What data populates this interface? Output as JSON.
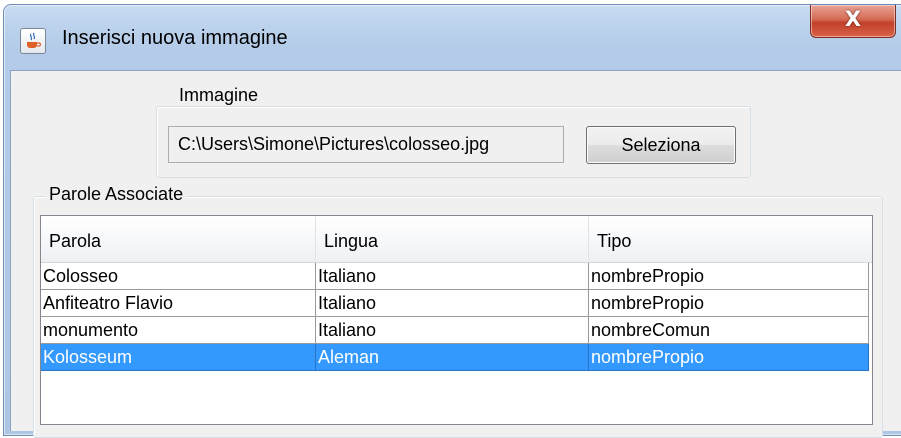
{
  "window": {
    "title": "Inserisci nuova immagine",
    "close_label": "X"
  },
  "image_group": {
    "legend": "Immagine",
    "path_value": "C:\\Users\\Simone\\Pictures\\colosseo.jpg",
    "select_button": "Seleziona"
  },
  "words_group": {
    "legend": "Parole Associate",
    "columns": [
      "Parola",
      "Lingua",
      "Tipo"
    ],
    "rows": [
      [
        "Colosseo",
        "Italiano",
        "nombrePropio"
      ],
      [
        "Anfiteatro Flavio",
        "Italiano",
        "nombrePropio"
      ],
      [
        "monumento",
        "Italiano",
        "nombreComun"
      ],
      [
        "Kolosseum",
        "Aleman",
        "nombrePropio"
      ]
    ],
    "selected_row": 3
  },
  "colors": {
    "selection": "#3399ff",
    "close_button": "#c7432c",
    "title_bar": "#bcd2ec"
  },
  "icons": {
    "app": "java-coffee-cup-icon",
    "close": "close-icon"
  }
}
